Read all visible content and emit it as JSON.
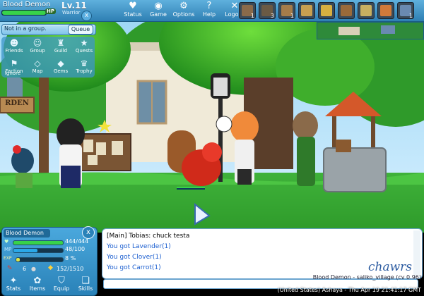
{
  "player": {
    "name": "Blood Demon",
    "level": "Lv.11",
    "class": "Warrior",
    "hp_label": "HP",
    "hp_value": "444/444",
    "hp_fraction": 1.0,
    "mp_value": "48/100",
    "mp_fraction": 0.48,
    "exp_label": "EXP",
    "exp_value": "8 %",
    "exp_fraction": 0.08,
    "gems": "6",
    "gold": "152/1510"
  },
  "top_nav": [
    {
      "label": "Status",
      "icon": "heart-icon"
    },
    {
      "label": "Game",
      "icon": "game-icon"
    },
    {
      "label": "Options",
      "icon": "options-icon"
    },
    {
      "label": "Help",
      "icon": "help-icon"
    },
    {
      "label": "Logout",
      "icon": "logout-icon"
    }
  ],
  "hotbar": [
    {
      "count": "1",
      "color": "#8a6a4a"
    },
    {
      "count": "3",
      "color": "#6b5a44"
    },
    {
      "count": "1",
      "color": "#a57c4a"
    },
    {
      "count": "",
      "color": "#c8a050"
    },
    {
      "count": "",
      "color": "#d8b040"
    },
    {
      "count": "",
      "color": "#9a6a3a"
    },
    {
      "count": "",
      "color": "#c8b060"
    },
    {
      "count": "",
      "color": "#d07a3a"
    },
    {
      "count": "1",
      "color": "#6a8ab0"
    }
  ],
  "group": {
    "status": "Not in a group.",
    "queue_label": "Queue"
  },
  "social_menu": [
    {
      "label": "Friends",
      "icon": "friends-icon"
    },
    {
      "label": "Group",
      "icon": "group-icon"
    },
    {
      "label": "Guild",
      "icon": "guild-icon"
    },
    {
      "label": "Quests",
      "icon": "quests-icon"
    },
    {
      "label": "Faction",
      "icon": "faction-icon"
    },
    {
      "label": "Map",
      "icon": "map-icon"
    },
    {
      "label": "Gems",
      "icon": "gems-icon"
    },
    {
      "label": "Trophy",
      "icon": "trophy-icon"
    }
  ],
  "faction_extra": "Ignore",
  "scene": {
    "sign_text": "RDEN"
  },
  "bottom_buttons": [
    {
      "label": "Stats",
      "icon": "stats-icon"
    },
    {
      "label": "Items",
      "icon": "items-icon"
    },
    {
      "label": "Equip",
      "icon": "equip-icon"
    },
    {
      "label": "Skills",
      "icon": "skills-icon"
    }
  ],
  "chat": {
    "lines": [
      {
        "text": "[Main] Tobias: chuck testa",
        "color": "#000000"
      },
      {
        "text": "You got Lavender(1)",
        "color": "#1c5fd0"
      },
      {
        "text": "You got Clover(1)",
        "color": "#1c5fd0"
      },
      {
        "text": "You got Carrot(1)",
        "color": "#1c5fd0"
      }
    ],
    "input_value": ""
  },
  "footer": {
    "brand": "chawrs",
    "line1": "Blood Demon - saliko_village (cv 0.96)",
    "line2": "(United States) Ashaya - Thu Apr 19 21:41:17 GMT"
  },
  "colors": {
    "hp": "#38d24a",
    "mp": "#2aa8e8",
    "exp": "#e0e64a",
    "accent": "#2e7fb3"
  }
}
